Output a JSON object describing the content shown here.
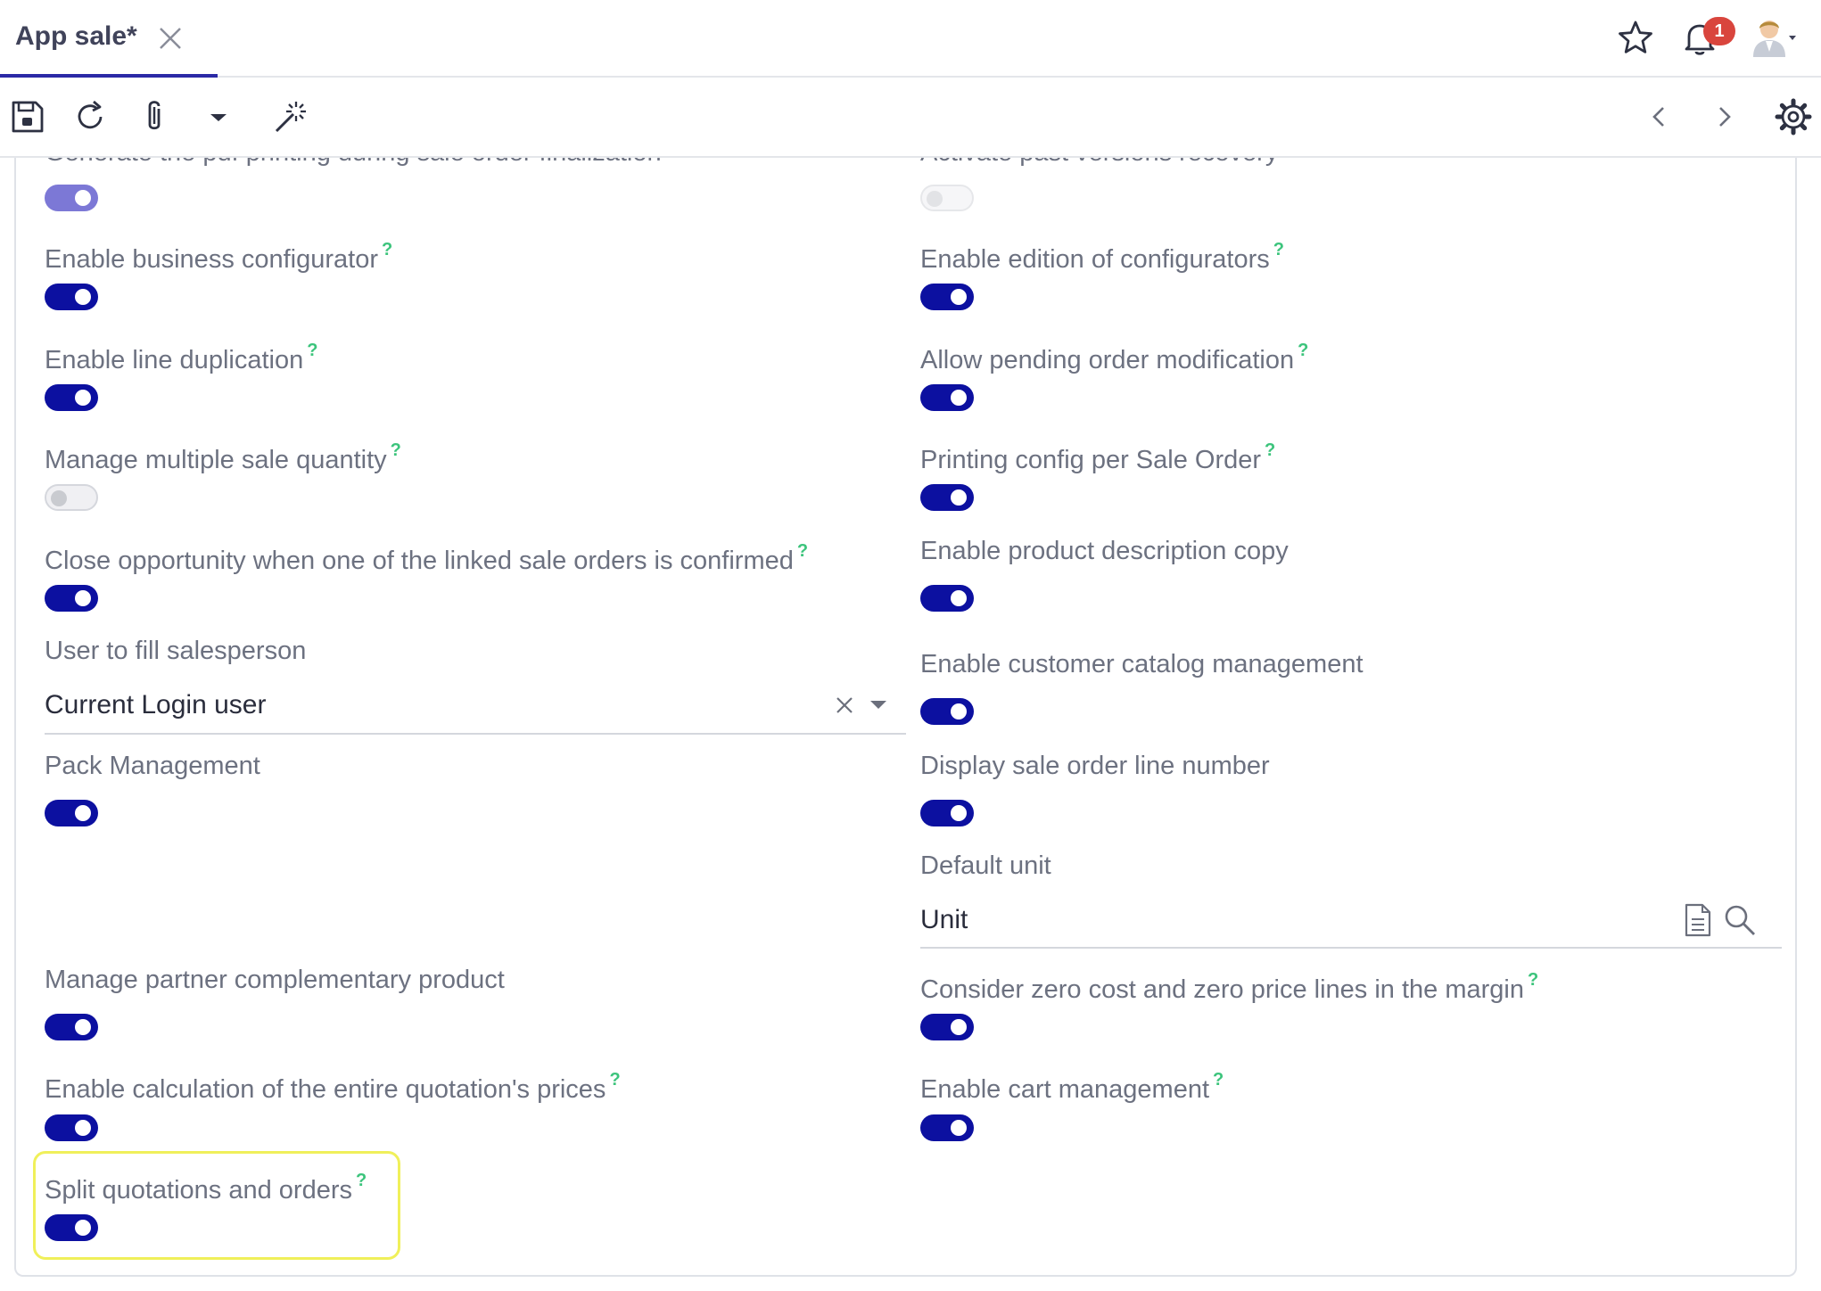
{
  "tab": {
    "title": "App sale*"
  },
  "header": {
    "notification_count": "1"
  },
  "icons": {
    "tab_close": "close-icon",
    "favorite": "star-icon",
    "notifications": "bell-icon",
    "user": "avatar-icon",
    "save": "save-icon",
    "refresh": "refresh-icon",
    "attachment": "paperclip-icon",
    "more": "caret-down-icon",
    "magic": "magic-wand-icon",
    "prev": "chevron-left-icon",
    "next": "chevron-right-icon",
    "settings": "gear-icon"
  },
  "colors": {
    "toggle_on": "#0c10a0",
    "help": "#3cc47c",
    "tab_accent": "#2b2aa6",
    "highlight": "#f0f05a",
    "badge": "#d9453d"
  },
  "left": {
    "partial_label": "Generate the pdf printing during sale order finalization",
    "partial_state": "on",
    "business_configurator": {
      "label": "Enable business configurator",
      "help": "?",
      "state": "on"
    },
    "line_duplication": {
      "label": "Enable line duplication",
      "help": "?",
      "state": "on"
    },
    "multiple_quantity": {
      "label": "Manage multiple sale quantity",
      "help": "?",
      "state": "off"
    },
    "close_opportunity": {
      "label": "Close opportunity when one of the linked sale orders is confirmed",
      "help": "?",
      "state": "on"
    },
    "salesperson": {
      "label": "User to fill salesperson",
      "value": "Current Login user"
    },
    "pack_management": {
      "label": "Pack Management",
      "state": "on"
    },
    "complementary_product": {
      "label": "Manage partner complementary product",
      "state": "on"
    },
    "entire_quotation": {
      "label": "Enable calculation of the entire quotation's prices",
      "help": "?",
      "state": "on"
    },
    "split_quotations": {
      "label": "Split quotations and orders",
      "help": "?",
      "state": "on"
    }
  },
  "right": {
    "partial_label": "Activate past versions recovery",
    "partial_state": "off",
    "edition_configurators": {
      "label": "Enable edition of configurators",
      "help": "?",
      "state": "on"
    },
    "pending_order": {
      "label": "Allow pending order modification",
      "help": "?",
      "state": "on"
    },
    "printing_config": {
      "label": "Printing config per Sale Order",
      "help": "?",
      "state": "on"
    },
    "description_copy": {
      "label": "Enable product description copy",
      "state": "on"
    },
    "customer_catalog": {
      "label": "Enable customer catalog management",
      "state": "on"
    },
    "line_number": {
      "label": "Display sale order line number",
      "state": "on"
    },
    "default_unit": {
      "label": "Default unit",
      "value": "Unit"
    },
    "zero_cost": {
      "label": "Consider zero cost and zero price lines in the margin",
      "help": "?",
      "state": "on"
    },
    "cart_management": {
      "label": "Enable cart management",
      "help": "?",
      "state": "on"
    }
  }
}
